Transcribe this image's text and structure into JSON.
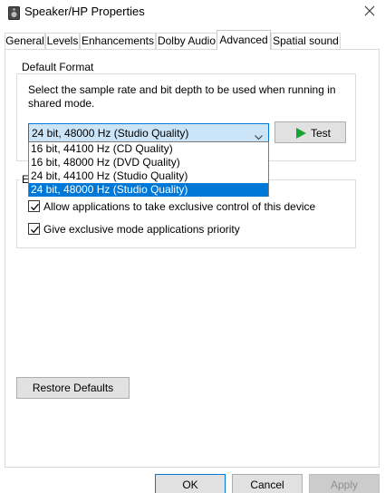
{
  "window": {
    "title": "Speaker/HP Properties",
    "app_icon": "speaker-icon",
    "close_icon": "close-icon"
  },
  "tabs": [
    {
      "label": "General",
      "active": false
    },
    {
      "label": "Levels",
      "active": false
    },
    {
      "label": "Enhancements",
      "active": false
    },
    {
      "label": "Dolby Audio",
      "active": false
    },
    {
      "label": "Advanced",
      "active": true
    },
    {
      "label": "Spatial sound",
      "active": false
    }
  ],
  "default_format": {
    "group_label": "Default Format",
    "description": "Select the sample rate and bit depth to be used when running in shared mode.",
    "selected_value": "24 bit, 48000 Hz (Studio Quality)",
    "options": [
      "16 bit, 44100 Hz (CD Quality)",
      "16 bit, 48000 Hz (DVD Quality)",
      "24 bit, 44100 Hz (Studio Quality)",
      "24 bit, 48000 Hz (Studio Quality)"
    ],
    "highlighted_index": 3,
    "test_button_label": "Test",
    "test_icon": "play-icon"
  },
  "exclusive_mode": {
    "group_label_visible": "E",
    "allow_exclusive_label": "Allow applications to take exclusive control of this device",
    "allow_exclusive_checked": true,
    "priority_label": "Give exclusive mode applications priority",
    "priority_checked": true
  },
  "footer": {
    "restore_defaults_label": "Restore Defaults",
    "ok_label": "OK",
    "cancel_label": "Cancel",
    "apply_label": "Apply",
    "apply_enabled": false
  },
  "colors": {
    "accent": "#0078d7",
    "select_bg": "#cce4f7",
    "play_green": "#15a630",
    "button_bg": "#e1e1e1"
  }
}
